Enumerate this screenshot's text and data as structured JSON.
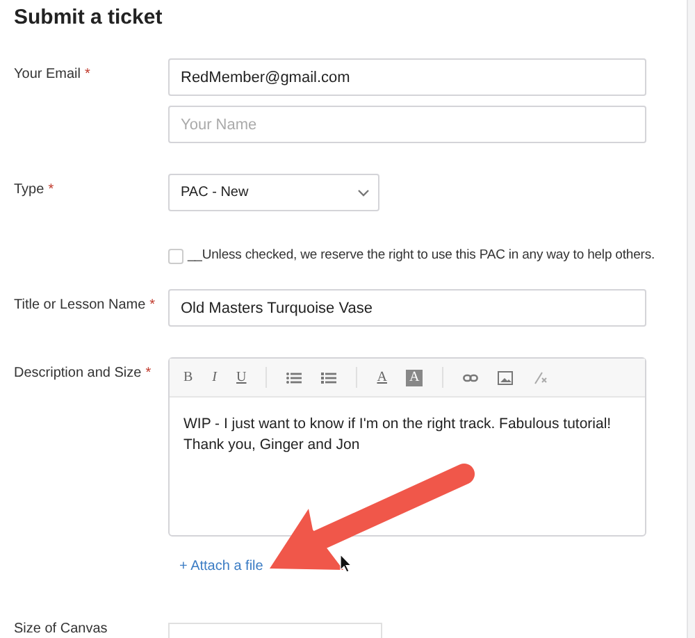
{
  "title": "Submit a ticket",
  "fields": [
    {
      "kind": "text",
      "label": "Your Email",
      "required_mark": "*",
      "inputs": [
        {
          "value": "RedMember@gmail.com"
        },
        {
          "placeholder": "Your Name"
        }
      ]
    },
    {
      "kind": "select",
      "label": "Type",
      "required_mark": "*",
      "value": "PAC - New"
    },
    {
      "kind": "checkbox",
      "text": "__Unless checked, we reserve the right to use this PAC in any way to help others.",
      "checked": false
    },
    {
      "kind": "text",
      "label": "Title or Lesson Name",
      "required_mark": "*",
      "inputs": [
        {
          "value": "Old Masters Turquoise Vase"
        }
      ]
    },
    {
      "kind": "editor",
      "label": "Description and Size",
      "required_mark": "*",
      "value": "WIP - I just want to know if I'm on the right track. Fabulous tutorial! Thank you, Ginger and Jon",
      "attach": "+ Attach a file",
      "toolbar": [
        {
          "kind": "bold",
          "text": "B"
        },
        {
          "kind": "italic",
          "text": "I"
        },
        {
          "kind": "underline",
          "text": "U"
        },
        {
          "kind": "separator"
        },
        {
          "kind": "bullets"
        },
        {
          "kind": "numbers"
        },
        {
          "kind": "separator"
        },
        {
          "kind": "text-color",
          "text": "A"
        },
        {
          "kind": "bg-color",
          "text": "A"
        },
        {
          "kind": "separator"
        },
        {
          "kind": "link"
        },
        {
          "kind": "image"
        },
        {
          "kind": "clear"
        }
      ]
    },
    {
      "kind": "short",
      "label": "Size of Canvas"
    }
  ]
}
